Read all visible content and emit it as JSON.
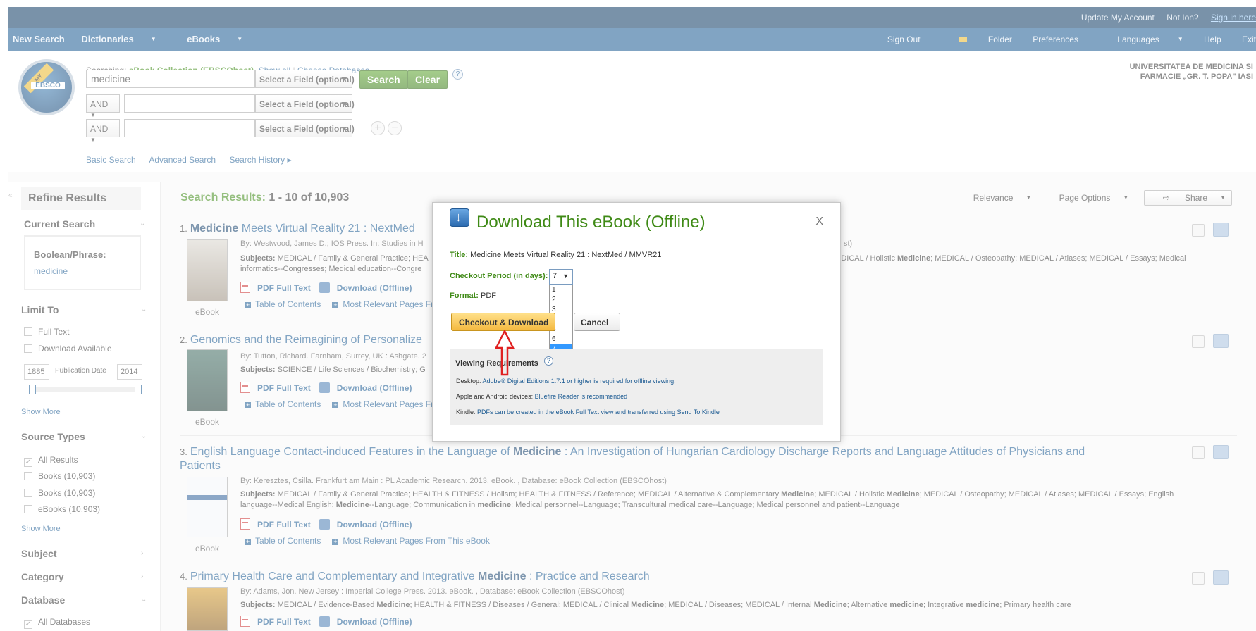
{
  "topbar": {
    "update_account": "Update My Account",
    "not_ion": "Not Ion?",
    "sign_in": "Sign in here"
  },
  "nav": {
    "left": [
      "New Search",
      "Dictionaries",
      "eBooks"
    ],
    "right": [
      "Sign Out",
      "Folder",
      "Preferences",
      "Languages",
      "Help",
      "Exit"
    ]
  },
  "search": {
    "searching_prefix": "Searching:",
    "database": "eBook Collection (EBSCOhost),",
    "show_all": "Show all",
    "choose_databases": "Choose Databases",
    "query": "medicine",
    "field_select": "Select a Field (optional)",
    "bool_op": "AND",
    "search_btn": "Search",
    "clear_btn": "Clear",
    "help": "?",
    "add": "+",
    "remove": "−",
    "links": [
      "Basic Search",
      "Advanced Search",
      "Search History ▸"
    ]
  },
  "logo": {
    "ribbon": "MY",
    "word": "EBSCO"
  },
  "institution": [
    "UNIVERSITATEA DE MEDICINA SI",
    "FARMACIE „GR. T. POPA\" IASI"
  ],
  "sidebar": {
    "refine": "Refine Results",
    "current_search": "Current Search",
    "boolean_label": "Boolean/Phrase:",
    "boolean_value": "medicine",
    "limit_to": "Limit To",
    "full_text": "Full Text",
    "download_available": "Download Available",
    "year_from": "1885",
    "year_to": "2014",
    "pub_date_label": "Publication Date",
    "show_more": "Show More",
    "source_types": "Source Types",
    "source_items": [
      "All Results",
      "Books (10,903)",
      "Books (10,903)",
      "eBooks (10,903)"
    ],
    "subject": "Subject",
    "category": "Category",
    "database": "Database",
    "all_databases": "All Databases"
  },
  "results": {
    "label": "Search Results:",
    "count": "1 - 10 of 10,903",
    "relevance": "Relevance",
    "page_options": "Page Options",
    "share": "Share",
    "pdf_full_text": "PDF Full Text",
    "download_offline": "Download (Offline)",
    "toc": "Table of Contents",
    "most_relevant": "Most Relevant Pages From This eBook",
    "ebook_label": "eBook",
    "items": [
      {
        "num": "1.",
        "title_bold": "Medicine",
        "title_rest": " Meets Virtual Reality 21 : NextMed",
        "meta": "By: Westwood, James D.; IOS Press. In: Studies in H",
        "meta_tail": "st)",
        "subj_a": "MEDICAL / Family & General Practice; HEA",
        "subj_b": "EDICAL / Holistic ",
        "subj_c": "; MEDICAL / Osteopathy; MEDICAL / Atlases; MEDICAL / Essays; Medical",
        "subj_line2": "informatics--Congresses; Medical education--Congre"
      },
      {
        "num": "2.",
        "title_rest": "Genomics and the Reimagining of Personalize",
        "meta": "By: Tutton, Richard. Farnham, Surrey, UK : Ashgate. 2",
        "subj_a": "SCIENCE / Life Sciences / Biochemistry; G",
        "most_relevant_trunc": "Most Relevant Pages Fro"
      },
      {
        "num": "3.",
        "title_a": "English Language Contact-induced Features in the Language of ",
        "title_bold": "Medicine",
        "title_b": " : An Investigation of Hungarian Cardiology Discharge Reports and Language Attitudes of Physicians and",
        "title_line2": "Patients",
        "meta": "By: Keresztes, Csilla. Frankfurt am Main : PL Academic Research. 2013. eBook. , Database: eBook Collection (EBSCOhost)",
        "subj_a": "MEDICAL / Family & General Practice; HEALTH & FITNESS / Holism; HEALTH & FITNESS / Reference; MEDICAL / Alternative & Complementary ",
        "subj_b": "; MEDICAL / Holistic ",
        "subj_c": "; MEDICAL / Osteopathy; MEDICAL / Atlases; MEDICAL / Essays; English",
        "subj_line2a": "language--Medical English; ",
        "subj_line2b": "--Language; Communication in ",
        "subj_line2c": "; Medical personnel--Language; Transcultural medical care--Language; Medical personnel and patient--Language"
      },
      {
        "num": "4.",
        "title_a": "Primary Health Care and Complementary and Integrative ",
        "title_bold": "Medicine",
        "title_b": " : Practice and Research",
        "meta": "By: Adams, Jon. New Jersey : Imperial College Press. 2013. eBook. , Database: eBook Collection (EBSCOhost)",
        "subj_a": "MEDICAL / Evidence-Based ",
        "subj_b": "; HEALTH & FITNESS / Diseases / General; MEDICAL / Clinical ",
        "subj_c": "; MEDICAL / Diseases; MEDICAL / Internal ",
        "subj_d": "; Alternative ",
        "subj_e": "; Integrative ",
        "subj_f": "; Primary health care"
      }
    ],
    "subjects_label": "Subjects:",
    "medicine_bold": "Medicine",
    "medicine_lower": "medicine"
  },
  "modal": {
    "title": "Download This eBook (Offline)",
    "close": "X",
    "title_label": "Title:",
    "title_value": "Medicine Meets Virtual Reality 21 : NextMed / MMVR21",
    "period_label": "Checkout Period (in days):",
    "period_value": "7",
    "period_options": [
      "1",
      "2",
      "3",
      "4",
      "5",
      "6",
      "7"
    ],
    "format_label": "Format:",
    "format_value": "PDF",
    "checkout_btn": "Checkout & Download",
    "cancel_btn": "Cancel",
    "viewing_req": "Viewing Requirements",
    "desktop_label": "Desktop:",
    "desktop_link": "Adobe® Digital Editions 1.7.1 or higher is required for offline viewing.",
    "mobile_label": "Apple and Android devices:",
    "mobile_link": "Bluefire Reader is recommended",
    "kindle_label": "Kindle:",
    "kindle_link": "PDFs can be created in the eBook Full Text view and transferred using Send To Kindle"
  },
  "colors": {
    "nav": "#1b5a92",
    "topline": "#0c3a63",
    "green": "#3f8a16",
    "link": "#1b5a92",
    "highlight": "#3399ff"
  }
}
